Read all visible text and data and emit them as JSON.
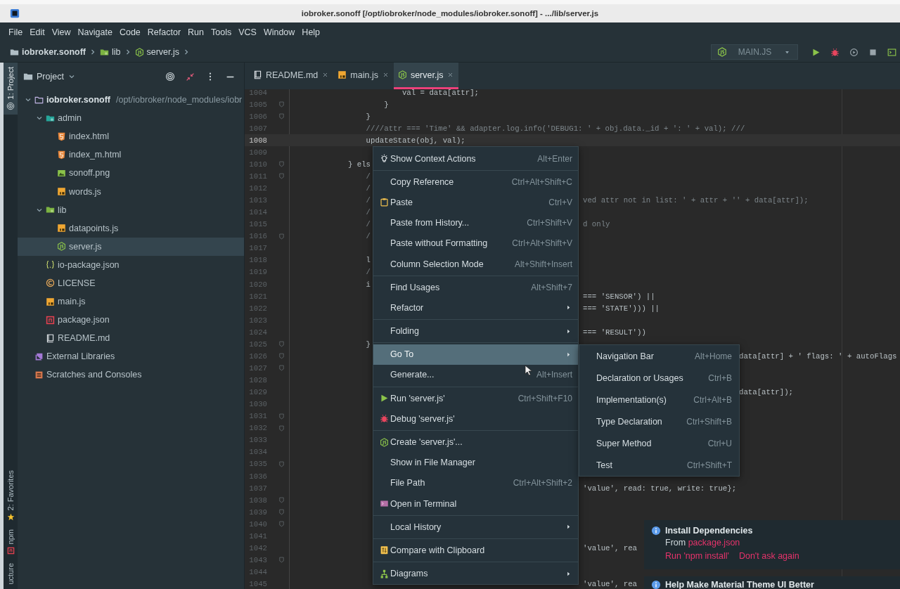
{
  "window": {
    "title": "iobroker.sonoff [/opt/iobroker/node_modules/iobroker.sonoff] - .../lib/server.js"
  },
  "menu_bar": [
    "File",
    "Edit",
    "View",
    "Navigate",
    "Code",
    "Refactor",
    "Run",
    "Tools",
    "VCS",
    "Window",
    "Help"
  ],
  "breadcrumb": [
    {
      "label": "iobroker.sonoff",
      "kind": "folder"
    },
    {
      "label": "lib",
      "kind": "source-folder"
    },
    {
      "label": "server.js",
      "kind": "node"
    }
  ],
  "run_config": {
    "label": "MAIN.JS"
  },
  "tool_strip": {
    "top": [
      {
        "label": "1: Project",
        "selected": true
      }
    ],
    "bottom": [
      {
        "label": "2: Favorites",
        "kind": "favorites",
        "selected": false
      },
      {
        "label": "npm",
        "kind": "npm",
        "selected": false
      },
      {
        "label": "ucture",
        "kind": "plain",
        "selected": false
      }
    ]
  },
  "project_panel": {
    "title": "Project"
  },
  "tree": [
    {
      "label": "iobroker.sonoff",
      "path": "/opt/iobroker/node_modules/iobr",
      "kind": "project",
      "expanded": true,
      "selected": false,
      "children": [
        {
          "label": "admin",
          "kind": "web-folder",
          "expanded": true,
          "selected": false,
          "children": [
            {
              "label": "index.html",
              "kind": "html",
              "selected": false
            },
            {
              "label": "index_m.html",
              "kind": "html",
              "selected": false
            },
            {
              "label": "sonoff.png",
              "kind": "image",
              "selected": false
            },
            {
              "label": "words.js",
              "kind": "js",
              "selected": false
            }
          ]
        },
        {
          "label": "lib",
          "kind": "source-folder",
          "expanded": true,
          "selected": false,
          "children": [
            {
              "label": "datapoints.js",
              "kind": "js",
              "selected": false
            },
            {
              "label": "server.js",
              "kind": "node",
              "selected": true
            }
          ]
        },
        {
          "label": "io-package.json",
          "kind": "json",
          "selected": false
        },
        {
          "label": "LICENSE",
          "kind": "license",
          "selected": false
        },
        {
          "label": "main.js",
          "kind": "js",
          "selected": false
        },
        {
          "label": "package.json",
          "kind": "npm",
          "selected": false
        },
        {
          "label": "README.md",
          "kind": "md",
          "selected": false
        }
      ]
    },
    {
      "label": "External Libraries",
      "kind": "libraries",
      "selected": false
    },
    {
      "label": "Scratches and Consoles",
      "kind": "scratches",
      "selected": false
    }
  ],
  "tabs": [
    {
      "label": "README.md",
      "kind": "md",
      "selected": false
    },
    {
      "label": "main.js",
      "kind": "js",
      "selected": false
    },
    {
      "label": "server.js",
      "kind": "node",
      "selected": true
    }
  ],
  "code": [
    {
      "n": "1004",
      "code": "                        val = data[attr];",
      "fold": false,
      "current": false,
      "kind": "code"
    },
    {
      "n": "1005",
      "code": "                    }",
      "fold": true,
      "current": false,
      "kind": "code"
    },
    {
      "n": "1006",
      "code": "                }",
      "fold": true,
      "current": false,
      "kind": "code"
    },
    {
      "n": "1007",
      "code": "                ////attr === 'Time' && adapter.log.info('DEBUG1: ' + obj.data._id + ': ' + val); ///",
      "fold": false,
      "current": false,
      "kind": "comment"
    },
    {
      "n": "1008",
      "code": "                updateState(obj, val);",
      "fold": false,
      "current": true,
      "kind": "code"
    },
    {
      "n": "1009",
      "fold": false,
      "current": false
    },
    {
      "n": "1010",
      "code": "            } els",
      "fold": true,
      "current": false,
      "kind": "code"
    },
    {
      "n": "1011",
      "code": "                /",
      "fold": true,
      "current": false,
      "kind": "comment"
    },
    {
      "n": "1012",
      "code": "                /",
      "fold": false,
      "current": false,
      "kind": "comment"
    },
    {
      "n": "1013",
      "code": "                /",
      "tail": "ved attr not in list: ' + attr + '' + data[attr]);",
      "fold": false,
      "current": false,
      "kind": "comment"
    },
    {
      "n": "1014",
      "code": "                /",
      "fold": false,
      "current": false,
      "kind": "comment"
    },
    {
      "n": "1015",
      "code": "                /",
      "tail": "d only",
      "fold": false,
      "current": false,
      "kind": "comment"
    },
    {
      "n": "1016",
      "code": "                /",
      "fold": true,
      "current": false,
      "kind": "comment"
    },
    {
      "n": "1017",
      "fold": false,
      "current": false
    },
    {
      "n": "1018",
      "code": "                l",
      "fold": false,
      "current": false,
      "kind": "code"
    },
    {
      "n": "1019",
      "code": "                /",
      "fold": false,
      "current": false,
      "kind": "comment"
    },
    {
      "n": "1020",
      "code": "                i",
      "fold": false,
      "current": false,
      "kind": "code"
    },
    {
      "n": "1021",
      "tail": "=== 'SENSOR') ||",
      "fold": false,
      "current": false,
      "kind": "code"
    },
    {
      "n": "1022",
      "tail": "=== 'STATE'))) ||",
      "fold": false,
      "current": false,
      "kind": "code"
    },
    {
      "n": "1023",
      "fold": false,
      "current": false
    },
    {
      "n": "1024",
      "tail": "=== 'RESULT'))",
      "fold": false,
      "current": false,
      "kind": "code"
    },
    {
      "n": "1025",
      "code": "                }",
      "fold": true,
      "current": false,
      "kind": "code"
    },
    {
      "n": "1026",
      "tail": "data[attr] + ' flags: ' + autoFlags",
      "fold": true,
      "current": false,
      "kind": "code"
    },
    {
      "n": "1027",
      "fold": true,
      "current": false
    },
    {
      "n": "1028",
      "fold": false,
      "current": false
    },
    {
      "n": "1029",
      "tail": "data[attr]);",
      "fold": false,
      "current": false,
      "kind": "code"
    },
    {
      "n": "1030",
      "fold": false,
      "current": false
    },
    {
      "n": "1031",
      "fold": true,
      "current": false
    },
    {
      "n": "1032",
      "fold": true,
      "current": false
    },
    {
      "n": "1033",
      "fold": false,
      "current": false
    },
    {
      "n": "1034",
      "fold": false,
      "current": false
    },
    {
      "n": "1035",
      "fold": true,
      "current": false
    },
    {
      "n": "1036",
      "fold": false,
      "current": false
    },
    {
      "n": "1037",
      "tail": "'value', read: true, write: true};",
      "fold": false,
      "current": false,
      "kind": "code"
    },
    {
      "n": "1038",
      "fold": true,
      "current": false
    },
    {
      "n": "1039",
      "fold": true,
      "current": false
    },
    {
      "n": "1040",
      "fold": true,
      "current": false
    },
    {
      "n": "1041",
      "fold": false,
      "current": false
    },
    {
      "n": "1042",
      "tail": "'value', rea",
      "fold": false,
      "current": false,
      "kind": "code"
    },
    {
      "n": "1043",
      "fold": true,
      "current": false
    },
    {
      "n": "1044",
      "fold": false,
      "current": false
    },
    {
      "n": "1045",
      "tail": "'value', rea",
      "fold": false,
      "current": false,
      "kind": "code"
    }
  ],
  "context_menu": {
    "items": [
      {
        "kind": "item",
        "label": "Show Context Actions",
        "shortcut": "Alt+Enter",
        "submenu": false,
        "selected": false
      },
      {
        "kind": "separator"
      },
      {
        "kind": "item",
        "label": "Copy Reference",
        "shortcut": "Ctrl+Alt+Shift+C",
        "submenu": false,
        "selected": false
      },
      {
        "kind": "item",
        "label": "Paste",
        "shortcut": "Ctrl+V",
        "submenu": false,
        "selected": false
      },
      {
        "kind": "item",
        "label": "Paste from History...",
        "shortcut": "Ctrl+Shift+V",
        "submenu": false,
        "selected": false
      },
      {
        "kind": "item",
        "label": "Paste without Formatting",
        "shortcut": "Ctrl+Alt+Shift+V",
        "submenu": false,
        "selected": false
      },
      {
        "kind": "item",
        "label": "Column Selection Mode",
        "shortcut": "Alt+Shift+Insert",
        "submenu": false,
        "selected": false
      },
      {
        "kind": "separator"
      },
      {
        "kind": "item",
        "label": "Find Usages",
        "shortcut": "Alt+Shift+7",
        "submenu": false,
        "selected": false
      },
      {
        "kind": "item",
        "label": "Refactor",
        "submenu": true,
        "selected": false
      },
      {
        "kind": "separator"
      },
      {
        "kind": "item",
        "label": "Folding",
        "submenu": true,
        "selected": false
      },
      {
        "kind": "separator"
      },
      {
        "kind": "item",
        "label": "Go To",
        "submenu": true,
        "selected": true
      },
      {
        "kind": "item",
        "label": "Generate...",
        "shortcut": "Alt+Insert",
        "submenu": false,
        "selected": false
      },
      {
        "kind": "separator"
      },
      {
        "kind": "item",
        "label": "Run 'server.js'",
        "shortcut": "Ctrl+Shift+F10",
        "submenu": false,
        "selected": false
      },
      {
        "kind": "item",
        "label": "Debug 'server.js'",
        "submenu": false,
        "selected": false
      },
      {
        "kind": "separator"
      },
      {
        "kind": "item",
        "label": "Create 'server.js'...",
        "submenu": false,
        "selected": false
      },
      {
        "kind": "item",
        "label": "Show in File Manager",
        "submenu": false,
        "selected": false
      },
      {
        "kind": "item",
        "label": "File Path",
        "shortcut": "Ctrl+Alt+Shift+2",
        "submenu": false,
        "selected": false
      },
      {
        "kind": "item",
        "label": "Open in Terminal",
        "submenu": false,
        "selected": false
      },
      {
        "kind": "separator"
      },
      {
        "kind": "item",
        "label": "Local History",
        "submenu": true,
        "selected": false
      },
      {
        "kind": "separator"
      },
      {
        "kind": "item",
        "label": "Compare with Clipboard",
        "submenu": false,
        "selected": false
      },
      {
        "kind": "separator"
      },
      {
        "kind": "item",
        "label": "Diagrams",
        "submenu": true,
        "selected": false
      }
    ]
  },
  "go_to_submenu": {
    "items": [
      {
        "label": "Navigation Bar",
        "shortcut": "Alt+Home",
        "selected": false
      },
      {
        "label": "Declaration or Usages",
        "shortcut": "Ctrl+B",
        "selected": false
      },
      {
        "label": "Implementation(s)",
        "shortcut": "Ctrl+Alt+B",
        "selected": false
      },
      {
        "label": "Type Declaration",
        "shortcut": "Ctrl+Shift+B",
        "selected": false
      },
      {
        "label": "Super Method",
        "shortcut": "Ctrl+U",
        "selected": false
      },
      {
        "label": "Test",
        "shortcut": "Ctrl+Shift+T",
        "selected": false
      }
    ]
  },
  "notifications": [
    {
      "title": "Install Dependencies",
      "text": "From",
      "link": "package.json",
      "actions": [
        "Run 'npm install'",
        "Don't ask again"
      ]
    },
    {
      "title": "Help Make Material Theme UI Better"
    }
  ]
}
